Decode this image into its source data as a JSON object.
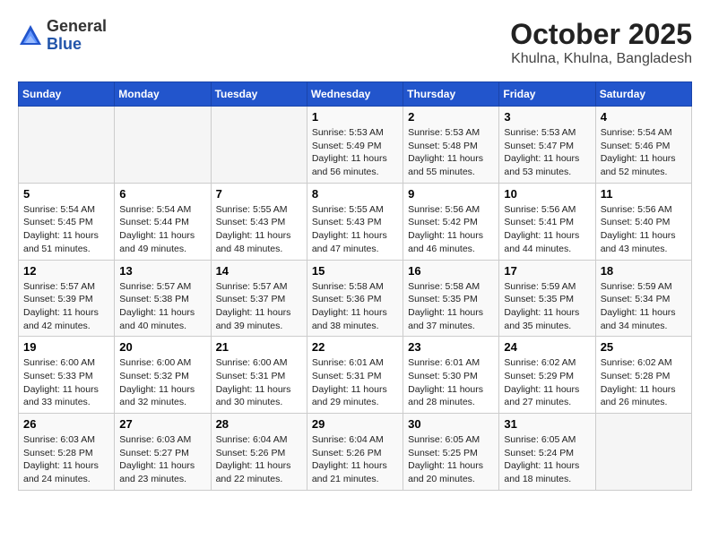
{
  "header": {
    "logo_general": "General",
    "logo_blue": "Blue",
    "month_title": "October 2025",
    "location": "Khulna, Khulna, Bangladesh"
  },
  "weekdays": [
    "Sunday",
    "Monday",
    "Tuesday",
    "Wednesday",
    "Thursday",
    "Friday",
    "Saturday"
  ],
  "weeks": [
    [
      {
        "day": "",
        "info": ""
      },
      {
        "day": "",
        "info": ""
      },
      {
        "day": "",
        "info": ""
      },
      {
        "day": "1",
        "info": "Sunrise: 5:53 AM\nSunset: 5:49 PM\nDaylight: 11 hours and 56 minutes."
      },
      {
        "day": "2",
        "info": "Sunrise: 5:53 AM\nSunset: 5:48 PM\nDaylight: 11 hours and 55 minutes."
      },
      {
        "day": "3",
        "info": "Sunrise: 5:53 AM\nSunset: 5:47 PM\nDaylight: 11 hours and 53 minutes."
      },
      {
        "day": "4",
        "info": "Sunrise: 5:54 AM\nSunset: 5:46 PM\nDaylight: 11 hours and 52 minutes."
      }
    ],
    [
      {
        "day": "5",
        "info": "Sunrise: 5:54 AM\nSunset: 5:45 PM\nDaylight: 11 hours and 51 minutes."
      },
      {
        "day": "6",
        "info": "Sunrise: 5:54 AM\nSunset: 5:44 PM\nDaylight: 11 hours and 49 minutes."
      },
      {
        "day": "7",
        "info": "Sunrise: 5:55 AM\nSunset: 5:43 PM\nDaylight: 11 hours and 48 minutes."
      },
      {
        "day": "8",
        "info": "Sunrise: 5:55 AM\nSunset: 5:43 PM\nDaylight: 11 hours and 47 minutes."
      },
      {
        "day": "9",
        "info": "Sunrise: 5:56 AM\nSunset: 5:42 PM\nDaylight: 11 hours and 46 minutes."
      },
      {
        "day": "10",
        "info": "Sunrise: 5:56 AM\nSunset: 5:41 PM\nDaylight: 11 hours and 44 minutes."
      },
      {
        "day": "11",
        "info": "Sunrise: 5:56 AM\nSunset: 5:40 PM\nDaylight: 11 hours and 43 minutes."
      }
    ],
    [
      {
        "day": "12",
        "info": "Sunrise: 5:57 AM\nSunset: 5:39 PM\nDaylight: 11 hours and 42 minutes."
      },
      {
        "day": "13",
        "info": "Sunrise: 5:57 AM\nSunset: 5:38 PM\nDaylight: 11 hours and 40 minutes."
      },
      {
        "day": "14",
        "info": "Sunrise: 5:57 AM\nSunset: 5:37 PM\nDaylight: 11 hours and 39 minutes."
      },
      {
        "day": "15",
        "info": "Sunrise: 5:58 AM\nSunset: 5:36 PM\nDaylight: 11 hours and 38 minutes."
      },
      {
        "day": "16",
        "info": "Sunrise: 5:58 AM\nSunset: 5:35 PM\nDaylight: 11 hours and 37 minutes."
      },
      {
        "day": "17",
        "info": "Sunrise: 5:59 AM\nSunset: 5:35 PM\nDaylight: 11 hours and 35 minutes."
      },
      {
        "day": "18",
        "info": "Sunrise: 5:59 AM\nSunset: 5:34 PM\nDaylight: 11 hours and 34 minutes."
      }
    ],
    [
      {
        "day": "19",
        "info": "Sunrise: 6:00 AM\nSunset: 5:33 PM\nDaylight: 11 hours and 33 minutes."
      },
      {
        "day": "20",
        "info": "Sunrise: 6:00 AM\nSunset: 5:32 PM\nDaylight: 11 hours and 32 minutes."
      },
      {
        "day": "21",
        "info": "Sunrise: 6:00 AM\nSunset: 5:31 PM\nDaylight: 11 hours and 30 minutes."
      },
      {
        "day": "22",
        "info": "Sunrise: 6:01 AM\nSunset: 5:31 PM\nDaylight: 11 hours and 29 minutes."
      },
      {
        "day": "23",
        "info": "Sunrise: 6:01 AM\nSunset: 5:30 PM\nDaylight: 11 hours and 28 minutes."
      },
      {
        "day": "24",
        "info": "Sunrise: 6:02 AM\nSunset: 5:29 PM\nDaylight: 11 hours and 27 minutes."
      },
      {
        "day": "25",
        "info": "Sunrise: 6:02 AM\nSunset: 5:28 PM\nDaylight: 11 hours and 26 minutes."
      }
    ],
    [
      {
        "day": "26",
        "info": "Sunrise: 6:03 AM\nSunset: 5:28 PM\nDaylight: 11 hours and 24 minutes."
      },
      {
        "day": "27",
        "info": "Sunrise: 6:03 AM\nSunset: 5:27 PM\nDaylight: 11 hours and 23 minutes."
      },
      {
        "day": "28",
        "info": "Sunrise: 6:04 AM\nSunset: 5:26 PM\nDaylight: 11 hours and 22 minutes."
      },
      {
        "day": "29",
        "info": "Sunrise: 6:04 AM\nSunset: 5:26 PM\nDaylight: 11 hours and 21 minutes."
      },
      {
        "day": "30",
        "info": "Sunrise: 6:05 AM\nSunset: 5:25 PM\nDaylight: 11 hours and 20 minutes."
      },
      {
        "day": "31",
        "info": "Sunrise: 6:05 AM\nSunset: 5:24 PM\nDaylight: 11 hours and 18 minutes."
      },
      {
        "day": "",
        "info": ""
      }
    ]
  ]
}
